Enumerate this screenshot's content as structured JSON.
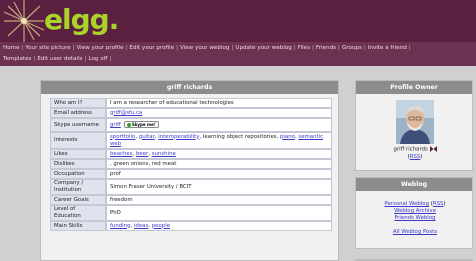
{
  "app": {
    "logo_text": "elgg."
  },
  "nav": {
    "row1": [
      "Home",
      "Your site picture",
      "View your profile",
      "Edit your profile",
      "View your weblog",
      "Update your weblog",
      "Files",
      "Friends",
      "Groups",
      "Invite a friend"
    ],
    "row2": [
      "Templates",
      "Edit user details",
      "Log off"
    ]
  },
  "profile": {
    "title": "griff richards",
    "rows": [
      {
        "label": "Who am I?",
        "value": "I am a researcher of educational technologies"
      },
      {
        "label": "Email address",
        "value": "griff@sfu.ca"
      },
      {
        "label": "Skype username",
        "value": "griff",
        "badge": "Skype me!"
      },
      {
        "label": "Interests",
        "links": [
          "sportfolio",
          "guitar",
          "interoperability"
        ],
        "middle": ", learning object repositories, ",
        "links2": [
          "piano",
          "semantic web"
        ]
      },
      {
        "label": "Likes",
        "links": [
          "beaches",
          "beer",
          "sunshine"
        ]
      },
      {
        "label": "Dislikes",
        "value": ", green onions, red meat"
      },
      {
        "label": "Occupation",
        "value": "prof"
      },
      {
        "label": "Company / Institution",
        "value": "Simon Fraser University / BCIT"
      },
      {
        "label": "Career Goals",
        "value": "freedom"
      },
      {
        "label": "Level of Education",
        "value": "PhD"
      },
      {
        "label": "Main Skills",
        "links": [
          "funding",
          "ideas",
          "people"
        ]
      }
    ]
  },
  "owner_panel": {
    "title": "Profile Owner",
    "name": "griff richards",
    "rss_label": "RSS",
    "icon": "friend-icon"
  },
  "weblog_panel": {
    "title": "Weblog",
    "personal_label": "Personal Weblog",
    "personal_rss": "RSS",
    "archive_label": "Weblog Archive",
    "friends_label": "Friends Weblog",
    "all_label": "All Weblog Posts"
  },
  "colors": {
    "header": "#5b1f3f",
    "nav": "#6d3252",
    "logo": "#a9d32a",
    "panel_head": "#8c8c8c",
    "link": "#3a3acb"
  }
}
